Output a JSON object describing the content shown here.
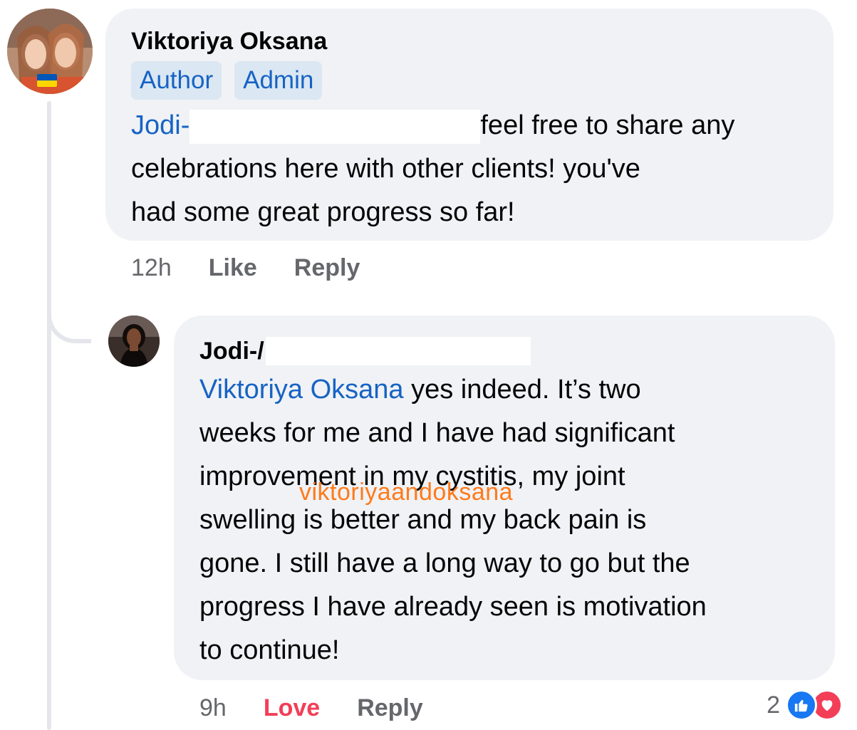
{
  "comment": {
    "author": "Viktoriya Oksana",
    "badges": [
      "Author",
      "Admin"
    ],
    "mention": "Jodi-",
    "text_line1": "feel free to share any",
    "text_line2": "celebrations here with other clients! you've",
    "text_line3": "had some great progress so far!",
    "time": "12h",
    "like_label": "Like",
    "reply_label": "Reply"
  },
  "reply": {
    "author": "Jodi-/",
    "mention": "Viktoriya Oksana",
    "text_line1": " yes indeed. It’s two",
    "text_line2": "weeks for me and I have had significant",
    "text_line3": "improvement in my cystitis, my joint",
    "text_line4": "swelling is better and my back pain is",
    "text_line5": "gone. I still have a long way to go but the",
    "text_line6": "progress I have already seen is motivation",
    "text_line7": "to continue!",
    "time": "9h",
    "love_label": "Love",
    "reply_label": "Reply",
    "reaction_count": "2",
    "reaction_icons": [
      "like-icon",
      "love-icon"
    ]
  },
  "watermark": "viktoriyaandoksana",
  "colors": {
    "bubble": "#f0f2f5",
    "mention": "#1763c4",
    "love": "#f33e58",
    "like": "#1877f2",
    "watermark": "#ff7a1a"
  }
}
